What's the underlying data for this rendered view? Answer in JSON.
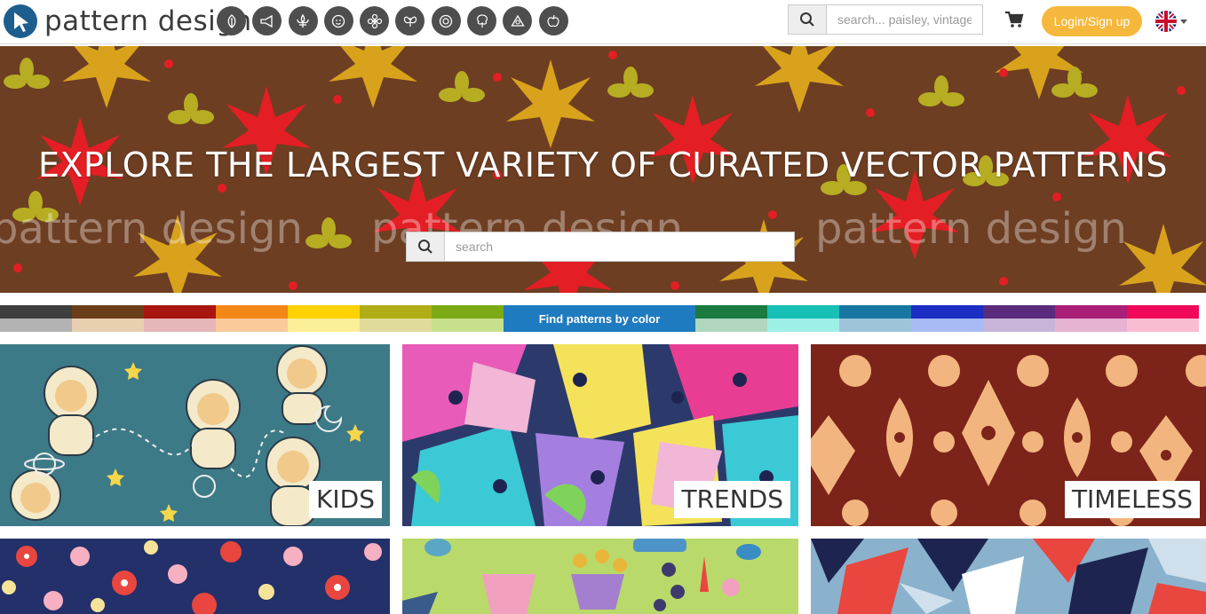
{
  "header": {
    "logo_text": "pattern design",
    "categories": [
      {
        "icon": "leaf-category-icon"
      },
      {
        "icon": "megaphone-category-icon"
      },
      {
        "icon": "fleur-de-lis-category-icon"
      },
      {
        "icon": "face-category-icon"
      },
      {
        "icon": "flower-category-icon"
      },
      {
        "icon": "butterfly-category-icon"
      },
      {
        "icon": "circle-category-icon"
      },
      {
        "icon": "tree-category-icon"
      },
      {
        "icon": "triangle-category-icon"
      },
      {
        "icon": "apple-category-icon"
      }
    ],
    "search_placeholder": "search... paisley, vintage",
    "login_label": "Login/Sign up",
    "language": "English"
  },
  "hero": {
    "title": "EXPLORE THE LARGEST VARIETY OF CURATED VECTOR PATTERNS",
    "watermark": "pattern design",
    "search_placeholder": "search"
  },
  "color_filter": {
    "label": "Find patterns by color",
    "swatches": [
      {
        "name": "gray",
        "dark": "#3e3e3e",
        "light": "#b3b3b3"
      },
      {
        "name": "brown",
        "dark": "#6b3e1a",
        "light": "#e8cfb0"
      },
      {
        "name": "red",
        "dark": "#a9150f",
        "light": "#e6b6b8"
      },
      {
        "name": "orange",
        "dark": "#f38717",
        "light": "#f8ca9c"
      },
      {
        "name": "yellow",
        "dark": "#fdd200",
        "light": "#fbef97"
      },
      {
        "name": "olive",
        "dark": "#b0ad16",
        "light": "#e0db9a"
      },
      {
        "name": "green-light",
        "dark": "#7caa14",
        "light": "#c7e08d"
      },
      {
        "name": "green",
        "dark": "#1a7a40",
        "light": "#b0d6be"
      },
      {
        "name": "turquoise",
        "dark": "#17bfb4",
        "light": "#9ef0e7"
      },
      {
        "name": "blue-light",
        "dark": "#1777a2",
        "light": "#9dc4d9"
      },
      {
        "name": "blue",
        "dark": "#1b2dc2",
        "light": "#a8bbf4"
      },
      {
        "name": "purple",
        "dark": "#5a2b7c",
        "light": "#c7b4d8"
      },
      {
        "name": "pink-dark",
        "dark": "#a91f77",
        "light": "#e6b3d3"
      },
      {
        "name": "pink",
        "dark": "#f0085a",
        "light": "#f9bdd2"
      }
    ]
  },
  "tiles": [
    {
      "label": "KIDS",
      "bg": "#3d7a87"
    },
    {
      "label": "TRENDS",
      "bg": "#2c3a6b"
    },
    {
      "label": "TIMELESS",
      "bg": "#7c241a"
    },
    {
      "label": "",
      "bg": "#23306a"
    },
    {
      "label": "",
      "bg": "#b9d96a"
    },
    {
      "label": "",
      "bg": "#8ab2cc"
    }
  ]
}
